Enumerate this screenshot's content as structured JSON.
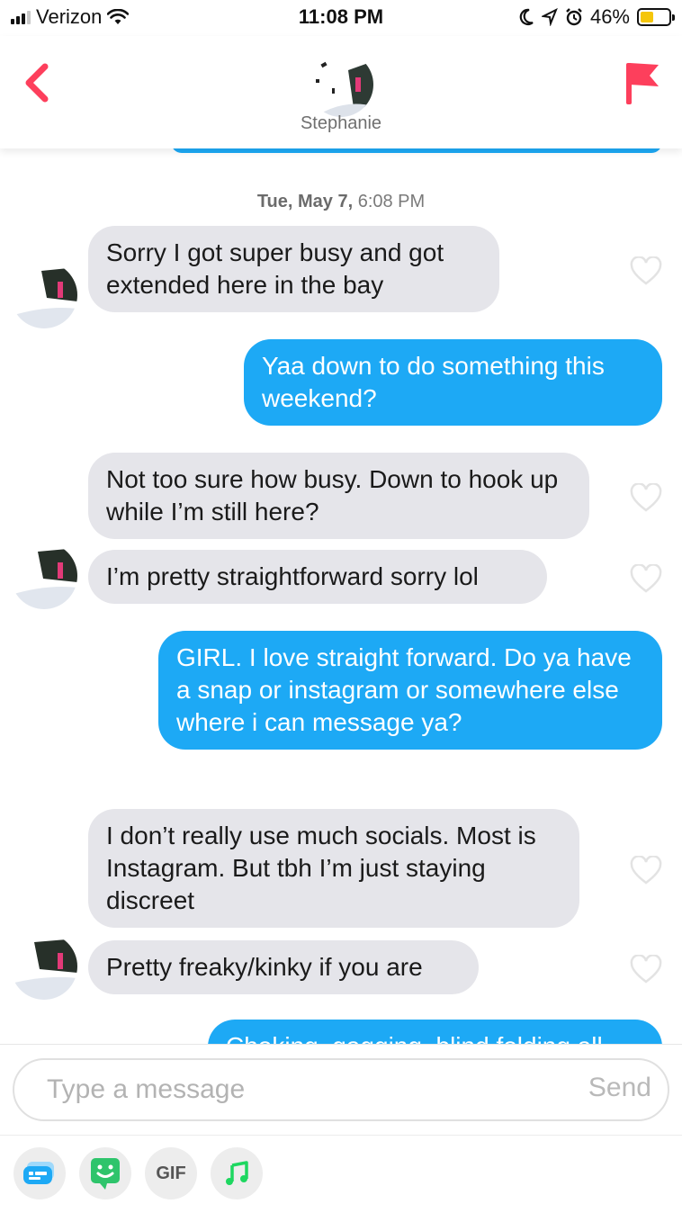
{
  "status_bar": {
    "carrier": "Verizon",
    "time": "11:08 PM",
    "battery": "46%",
    "battery_level": 0.46
  },
  "header": {
    "contact_name": "Stephanie"
  },
  "chat": {
    "timestamp_day": "Tue, May 7,",
    "timestamp_time": "6:08 PM",
    "messages": [
      {
        "from": "them",
        "text": "Sorry I got super busy and got extended here in the bay"
      },
      {
        "from": "me",
        "text": "Yaa down to do something this weekend?"
      },
      {
        "from": "them",
        "text": "Not too sure how busy. Down to hook up while I’m still here?"
      },
      {
        "from": "them",
        "text": "I’m pretty straightforward sorry lol"
      },
      {
        "from": "me",
        "text": "GIRL. I love straight forward. Do ya have a snap or instagram or somewhere else where i can message ya?"
      },
      {
        "from": "them",
        "text": "I don’t really use much socials.  Most is Instagram. But tbh I’m just staying discreet"
      },
      {
        "from": "them",
        "text": "Pretty freaky/kinky if you are"
      },
      {
        "from": "me",
        "text": "Choking, gagging, blind folding all"
      }
    ]
  },
  "composer": {
    "placeholder": "Type a message",
    "send_label": "Send",
    "gif_label": "GIF"
  },
  "colors": {
    "accent_red": "#fd3f5c",
    "outgoing_bubble": "#1da9f5",
    "incoming_bubble": "#e5e5ea",
    "spotify_green": "#1ed760"
  }
}
